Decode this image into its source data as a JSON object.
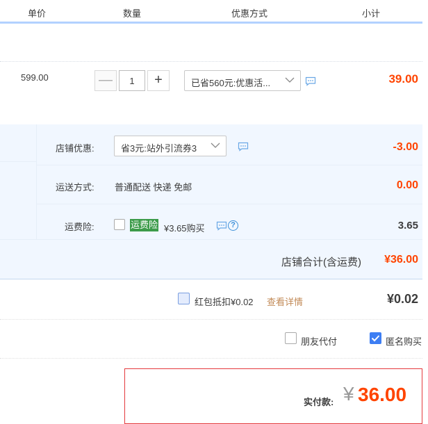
{
  "header": {
    "col_price": "单价",
    "col_qty": "数量",
    "col_discount": "优惠方式",
    "col_subtotal": "小计"
  },
  "item": {
    "unit_price": "599.00",
    "quantity": "1",
    "minus": "—",
    "plus": "+",
    "discount_select": "已省560元:优惠活...",
    "subtotal": "39.00"
  },
  "shop": {
    "coupon_label": "店铺优惠:",
    "coupon_select": "省3元:站外引流券3",
    "coupon_amount": "-3.00",
    "shipping_label": "运送方式:",
    "shipping_value": "普通配送 快递 免邮",
    "shipping_amount": "0.00",
    "insurance_label": "运费险:",
    "insurance_tag": "运费险",
    "insurance_price": "¥3.65购买",
    "insurance_amount": "3.65",
    "insurance_help": "?",
    "total_label": "店铺合计(含运费)",
    "total_amount": "¥36.00"
  },
  "redbag": {
    "label": "红包抵扣¥0.02",
    "link": "查看详情",
    "amount": "¥0.02"
  },
  "options": {
    "friend_pay": "朋友代付",
    "anonymous": "匿名购买"
  },
  "payment": {
    "label": "实付款:",
    "currency": "¥",
    "amount": "36.00"
  },
  "colors": {
    "accent_red": "#f40",
    "header_line": "#b2d1ff",
    "shop_bg": "#f1f7ff",
    "check_blue": "#3d7ef3",
    "insurance_green": "#3c9b4a"
  }
}
